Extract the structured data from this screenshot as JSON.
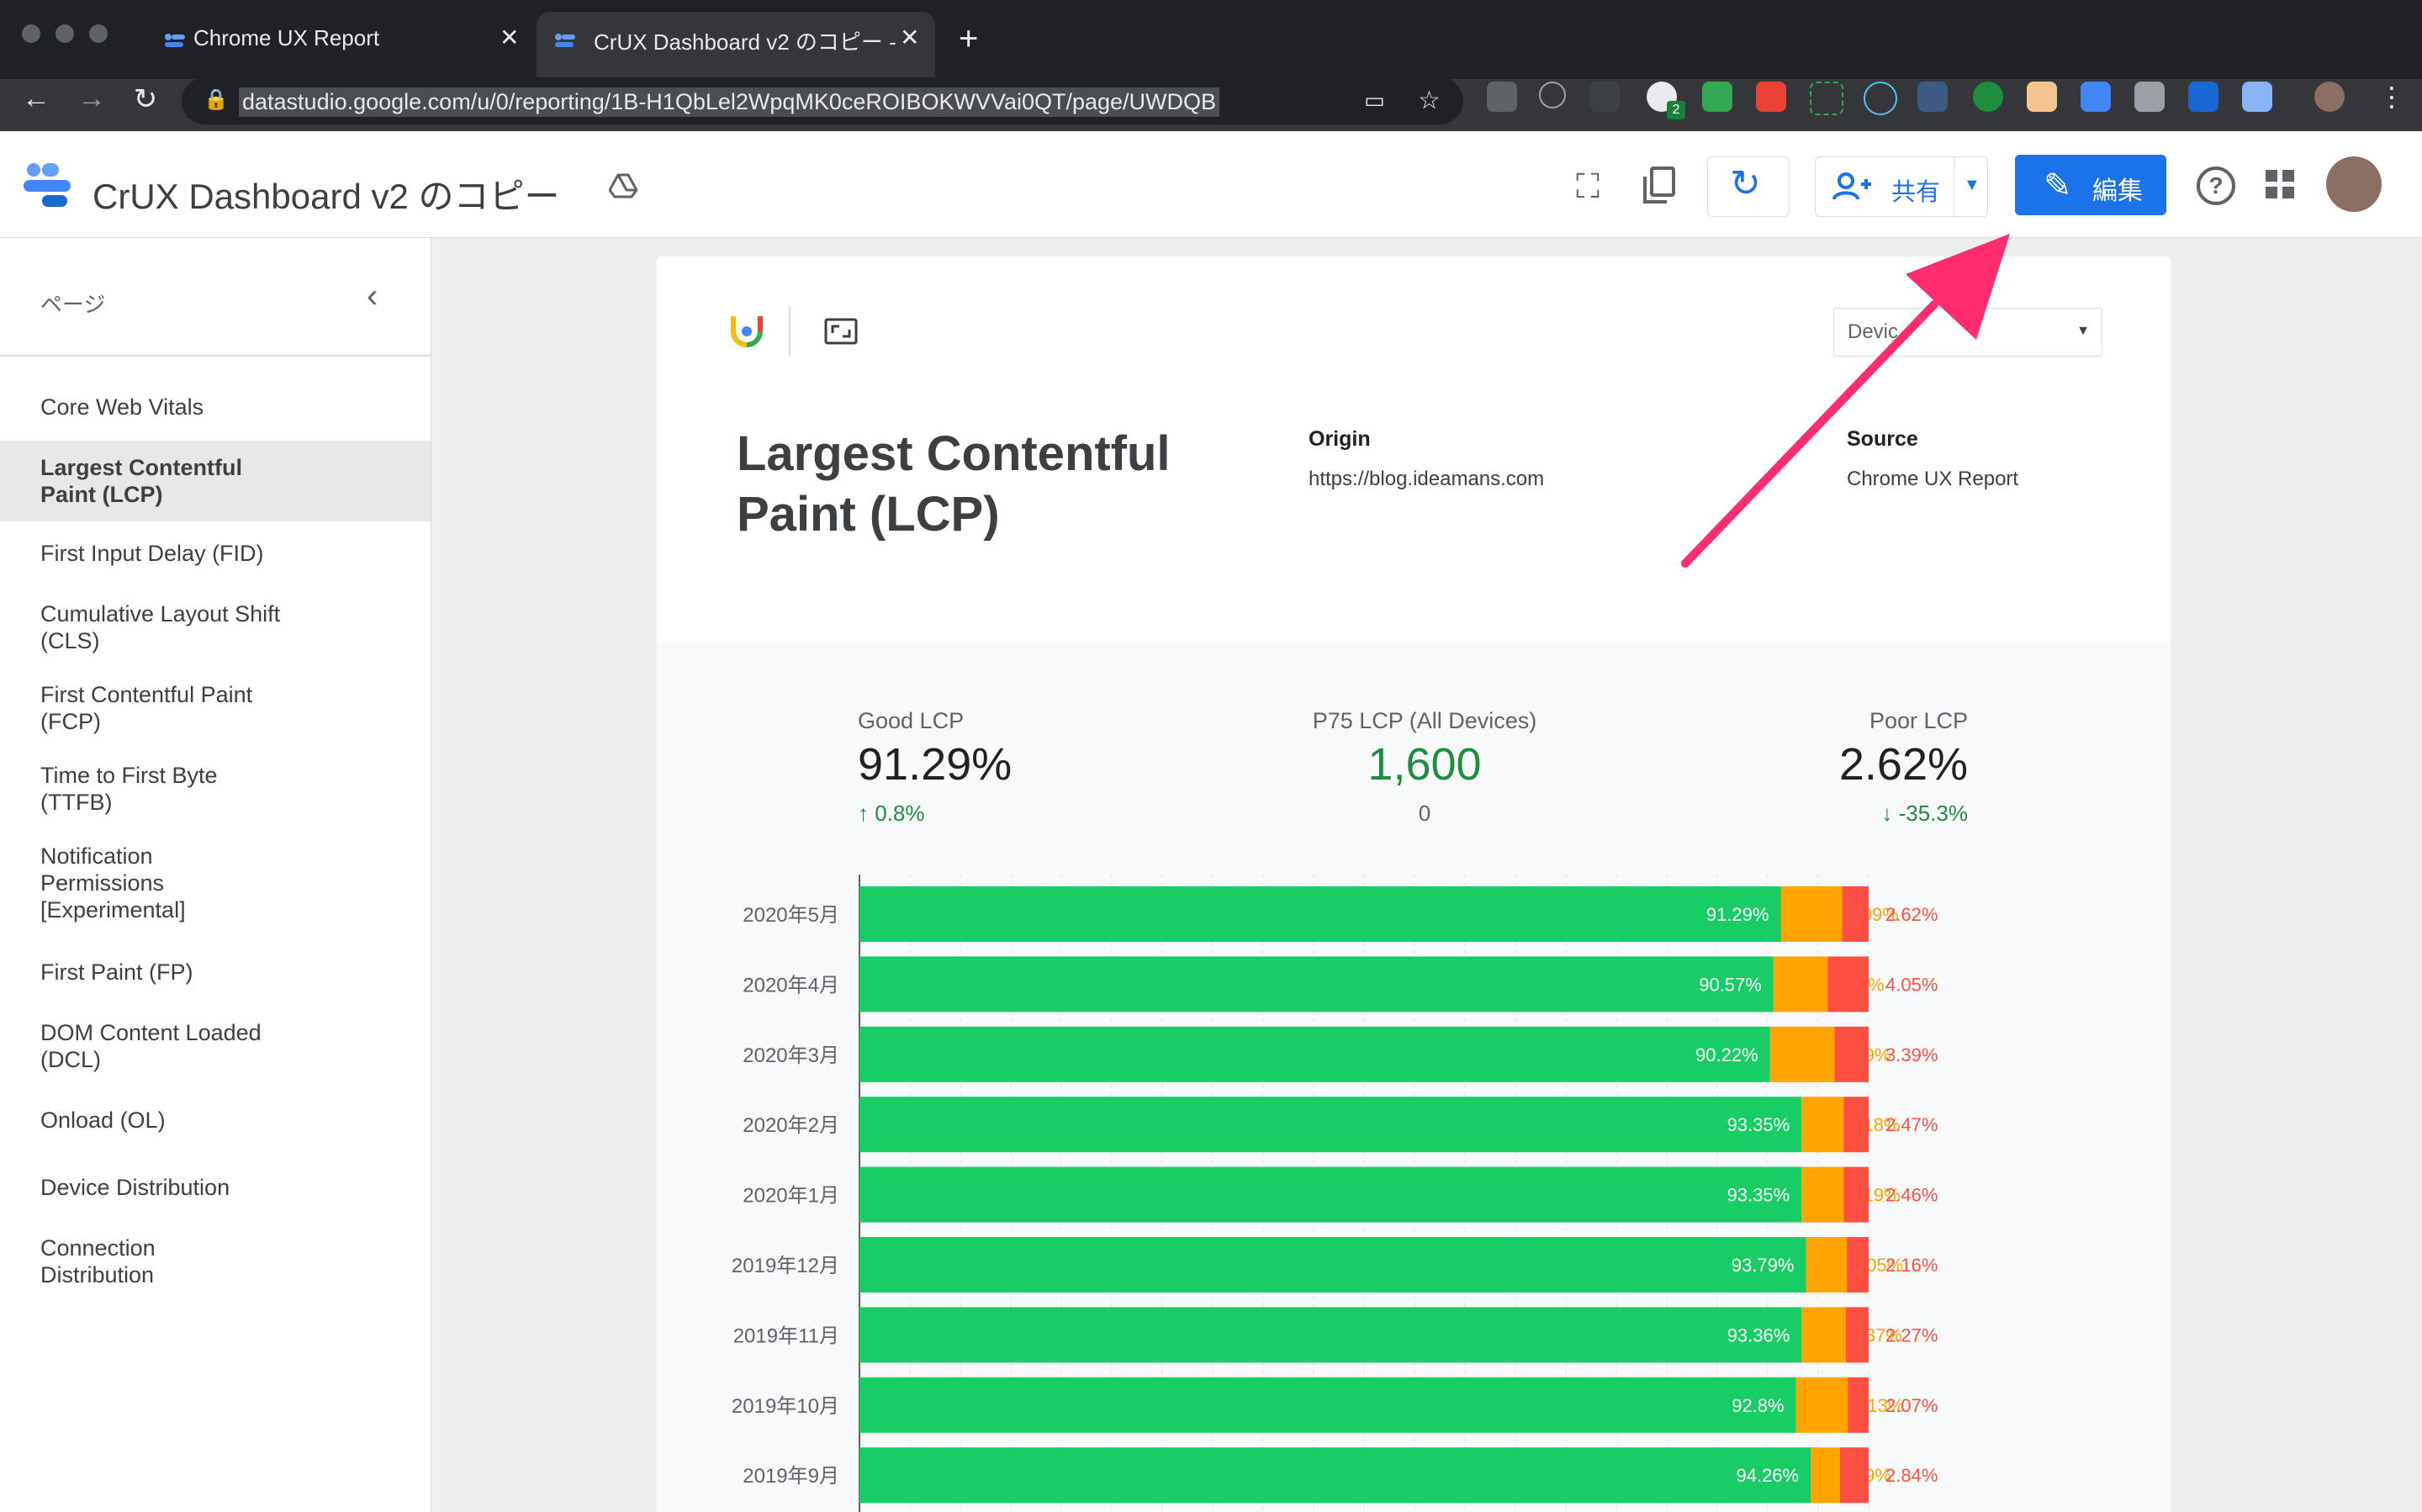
{
  "browser": {
    "tabs": [
      {
        "label": "Chrome UX Report",
        "active": false
      },
      {
        "label": "CrUX Dashboard v2 のコピー -",
        "active": true
      }
    ],
    "url": "datastudio.google.com/u/0/reporting/1B-H1QbLel2WpqMK0ceROIBOKWVVai0QT/page/UWDQB",
    "extension_badge": "2"
  },
  "header": {
    "title": "CrUX Dashboard v2 のコピー",
    "share_label": "共有",
    "edit_label": "編集",
    "accent": "#1a73e8"
  },
  "sidebar": {
    "section_label": "ページ",
    "items": [
      {
        "label": "Core Web Vitals"
      },
      {
        "label": "Largest Contentful Paint (LCP)",
        "active": true
      },
      {
        "label": "First Input Delay (FID)"
      },
      {
        "label": "Cumulative Layout Shift (CLS)"
      },
      {
        "label": "First Contentful Paint (FCP)"
      },
      {
        "label": "Time to First Byte (TTFB)"
      },
      {
        "label": "Notification Permissions [Experimental]"
      },
      {
        "label": "First Paint (FP)"
      },
      {
        "label": "DOM Content Loaded (DCL)"
      },
      {
        "label": "Onload (OL)"
      },
      {
        "label": "Device Distribution"
      },
      {
        "label": "Connection Distribution"
      }
    ]
  },
  "report": {
    "device_select": "Devic",
    "metric_title": "Largest Contentful Paint (LCP)",
    "origin_label": "Origin",
    "origin_value": "https://blog.ideamans.com",
    "source_label": "Source",
    "source_value": "Chrome UX Report",
    "kpis": {
      "good_label": "Good LCP",
      "good_value": "91.29%",
      "good_delta": "0.8%",
      "p75_label": "P75 LCP (All Devices)",
      "p75_value": "1,600",
      "p75_delta": "0",
      "poor_label": "Poor LCP",
      "poor_value": "2.62%",
      "poor_delta": "-35.3%"
    }
  },
  "chart_data": {
    "type": "bar",
    "orientation": "horizontal-stacked-100",
    "categories": [
      "2020年5月",
      "2020年4月",
      "2020年3月",
      "2020年2月",
      "2020年1月",
      "2019年12月",
      "2019年11月",
      "2019年10月",
      "2019年9月"
    ],
    "series": [
      {
        "values": [
          91.29,
          90.57,
          90.22,
          93.35,
          93.35,
          93.79,
          93.36,
          92.8,
          94.26
        ],
        "color": "#19cd66"
      },
      {
        "values": [
          6.09,
          5.38,
          6.39,
          4.18,
          4.19,
          4.05,
          4.37,
          5.13,
          2.9
        ],
        "color": "#ffa400"
      },
      {
        "values": [
          2.62,
          4.05,
          3.39,
          2.47,
          2.46,
          2.16,
          2.27,
          2.07,
          2.84
        ],
        "color": "#ff4e42"
      }
    ],
    "labels": [
      [
        "91.29%",
        "6.09%",
        "2.62%"
      ],
      [
        "90.57%",
        "5.38%",
        "4.05%"
      ],
      [
        "90.22%",
        "6.39%",
        "3.39%"
      ],
      [
        "93.35%",
        "4.18%",
        "2.47%"
      ],
      [
        "93.35%",
        "4.19%",
        "2.46%"
      ],
      [
        "93.79%",
        "4.05%",
        "2.16%"
      ],
      [
        "93.36%",
        "4.37%",
        "2.27%"
      ],
      [
        "92.8%",
        "5.13%",
        "2.07%"
      ],
      [
        "94.26%",
        "2.9%",
        "2.84%"
      ]
    ],
    "xlim": [
      0,
      100
    ]
  }
}
